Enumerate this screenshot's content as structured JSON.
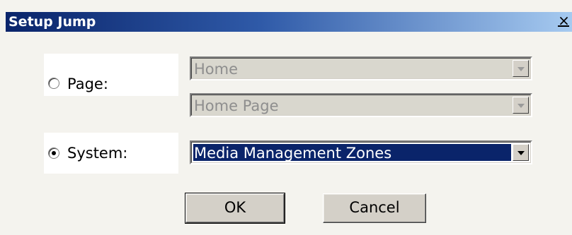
{
  "window": {
    "title": "Setup Jump",
    "close_glyph": "×"
  },
  "page_option": {
    "label": "Page:",
    "selected": false,
    "combo1_value": "Home",
    "combo2_value": "Home Page"
  },
  "system_option": {
    "label": "System:",
    "selected": true,
    "combo_value": "Media Management Zones"
  },
  "buttons": {
    "ok": "OK",
    "cancel": "Cancel"
  },
  "colors": {
    "titlebar_start": "#0a246a",
    "selection": "#0a246a",
    "dialog_bg": "#f4f3ee"
  }
}
